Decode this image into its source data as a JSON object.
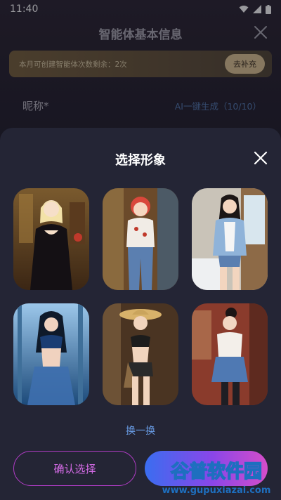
{
  "status_bar": {
    "time": "11:40"
  },
  "header": {
    "title": "智能体基本信息"
  },
  "quota": {
    "text": "本月可创建智能体次数剩余：2次",
    "button": "去补充"
  },
  "nickname": {
    "label": "昵称*",
    "generate": "AI一键生成（10/10）"
  },
  "sheet": {
    "title": "选择形象",
    "shuffle": "换一换",
    "confirm": "确认选择"
  },
  "avatars": [
    {
      "name": "avatar-blonde-black-dress"
    },
    {
      "name": "avatar-redhead-jeans"
    },
    {
      "name": "avatar-denim-jacket"
    },
    {
      "name": "avatar-blue-forest"
    },
    {
      "name": "avatar-straw-hat"
    },
    {
      "name": "avatar-denim-skirt"
    }
  ],
  "watermark": {
    "text": "谷普软件园",
    "url": "www.gupuxiazai.com"
  },
  "colors": {
    "accent_pink": "#d46be6",
    "accent_blue": "#6a9ee8",
    "sheet_bg": "#242535"
  }
}
